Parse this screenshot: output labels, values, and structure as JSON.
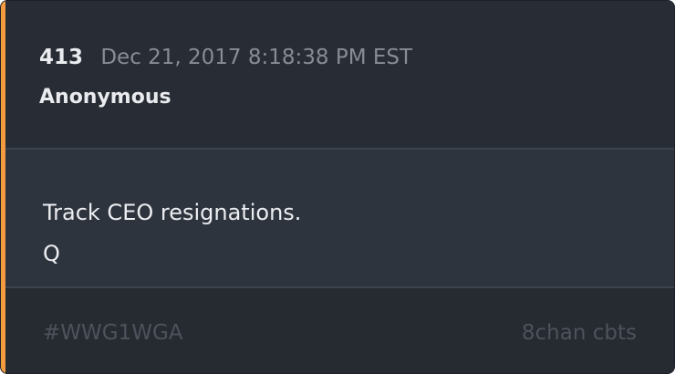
{
  "post": {
    "number": "413",
    "timestamp": "Dec 21, 2017 8:18:38 PM EST",
    "author": "Anonymous",
    "message_lines": [
      "Track CEO resignations.",
      "Q"
    ]
  },
  "footer": {
    "hashtag": "#WWG1WGA",
    "source": "8chan cbts"
  },
  "colors": {
    "accent": "#f49b3f",
    "header_bg": "#282d35",
    "body_bg": "#2e343e",
    "footer_bg": "#262a31"
  }
}
